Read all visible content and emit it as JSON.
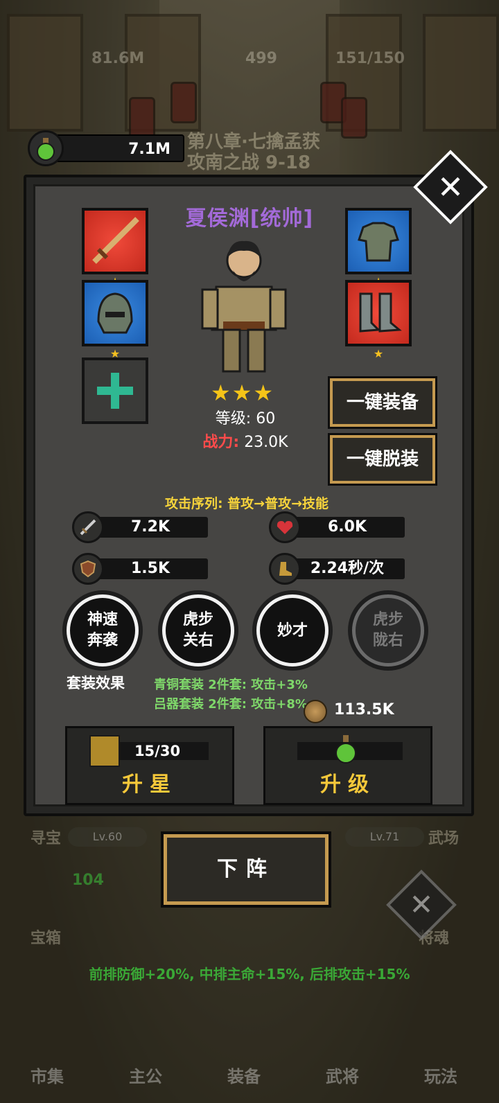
{
  "hud": {
    "gold_display": "81.6M",
    "gem_display": "499",
    "stamina_display": "151/150",
    "potion_value": "7.1M",
    "chapter_line1": "第八章·七擒孟获",
    "chapter_line2": "攻南之战 9-18"
  },
  "panel": {
    "hero_name": "夏侯渊[统帅]",
    "stars_count": 3,
    "level_label": "等级: 60",
    "power_label": "战力:",
    "power_value": "23.0K",
    "equip_all_label": "一键装备",
    "unequip_all_label": "一键脱装",
    "attack_sequence": "攻击序列: 普攻→普攻→技能",
    "stats": {
      "attack": "7.2K",
      "hp": "6.0K",
      "defense": "1.5K",
      "speed": "2.24秒/次"
    },
    "skills": [
      {
        "label_line1": "神速",
        "label_line2": "奔袭",
        "locked": false
      },
      {
        "label_line1": "虎步",
        "label_line2": "关右",
        "locked": false
      },
      {
        "label_line1": "妙才",
        "label_line2": "",
        "locked": false
      },
      {
        "label_line1": "虎步",
        "label_line2": "陇右",
        "locked": true
      }
    ],
    "set_effect_title": "套装效果",
    "set_effects": [
      "青铜套装 2件套:  攻击+3%",
      "吕器套装 2件套:  攻击+8%"
    ],
    "coin_value": "113.5K",
    "star_up": {
      "progress": "15/30",
      "label": "升星"
    },
    "level_up": {
      "progress": "0",
      "label": "升级"
    }
  },
  "bottom": {
    "left_label": "寻宝",
    "right_label": "武场",
    "left_level": "Lv.60",
    "right_level": "Lv.71",
    "chest_count": "104",
    "deploy_label": "下阵",
    "chest_label": "宝箱",
    "soul_label": "将魂",
    "formation_bonus": "前排防御+20%, 中排主命+15%, 后排攻击+15%",
    "nav": [
      "市集",
      "主公",
      "装备",
      "武将",
      "玩法"
    ]
  }
}
